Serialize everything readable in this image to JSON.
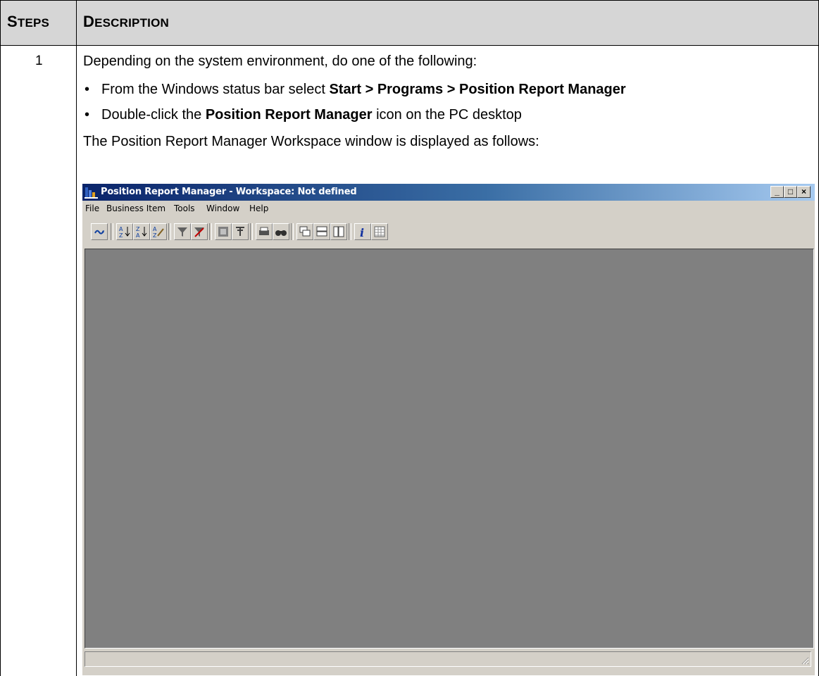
{
  "table": {
    "header_steps": "Steps",
    "header_description": "Description",
    "step_number": "1",
    "intro": "Depending on the system environment, do one of the following:",
    "bullet1": {
      "prefix": "From the Windows status bar select ",
      "bold": "Start > Programs > Position Report Manager"
    },
    "bullet2": {
      "prefix": "Double-click the ",
      "bold": "Position Report Manager",
      "suffix": " icon on the PC desktop"
    },
    "outro": "The Position Report Manager Workspace window is displayed as follows:"
  },
  "window": {
    "title": "Position Report Manager - Workspace: Not defined",
    "menu": [
      "File",
      "Business Item",
      "Tools",
      "Window",
      "Help"
    ],
    "caption_buttons": {
      "minimize": "_",
      "maximize": "□",
      "close": "×"
    },
    "toolbar_icons": [
      "refresh-icon",
      "sort-ascending-icon",
      "sort-descending-icon",
      "sort-custom-icon",
      "filter-icon",
      "filter-clear-icon",
      "grid-icon",
      "tree-icon",
      "print-icon",
      "find-icon",
      "cascade-icon",
      "tile-horizontal-icon",
      "tile-vertical-icon",
      "info-icon",
      "table-icon"
    ],
    "colors": {
      "title_gradient_start": "#0a246a",
      "title_gradient_end": "#a6caf0",
      "chrome": "#d4d0c8",
      "workspace": "#808080"
    }
  }
}
